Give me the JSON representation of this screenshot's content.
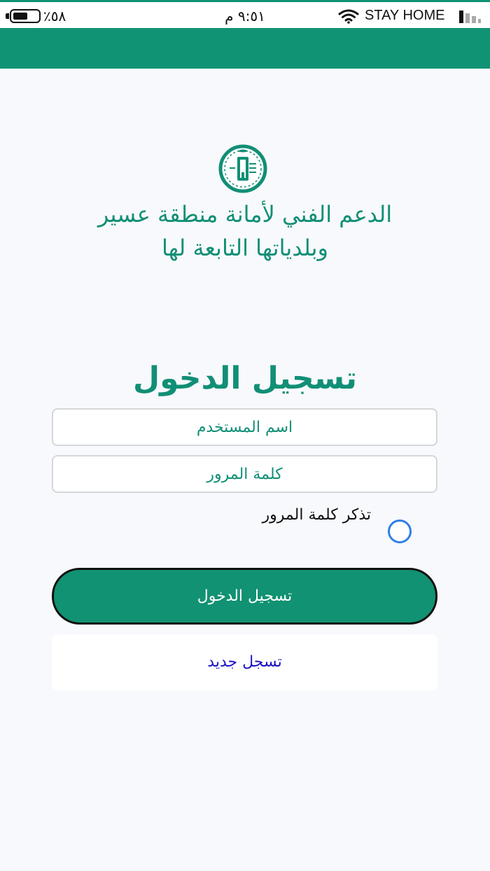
{
  "status_bar": {
    "battery": "٪٥٨",
    "battery_level": 0.58,
    "time": "٩:٥١ م",
    "carrier": "STAY HOME",
    "icons": [
      "battery-icon",
      "wifi-icon",
      "signal-icon"
    ],
    "background_color": "#109374"
  },
  "header": {
    "logo_icon": "amanah-asir-logo-icon",
    "title_line1": "الدعم الفني لأمانة منطقة عسير",
    "title_line2": "وبلدياتها التابعة لها"
  },
  "login_form": {
    "heading": "تسجيل الدخول",
    "username_placeholder": "اسم المستخدم",
    "password_placeholder": "كلمة المرور",
    "remember_label": "تذكر كلمة المرور",
    "remember_checked": false,
    "submit_label": "تسجيل الدخول",
    "register_label": "تسجل جديد"
  },
  "colors": {
    "accent": "#118f76",
    "button": "#119272",
    "link": "#1d14c4",
    "radio": "#2f7fe8",
    "background": "#f8f9fd"
  }
}
